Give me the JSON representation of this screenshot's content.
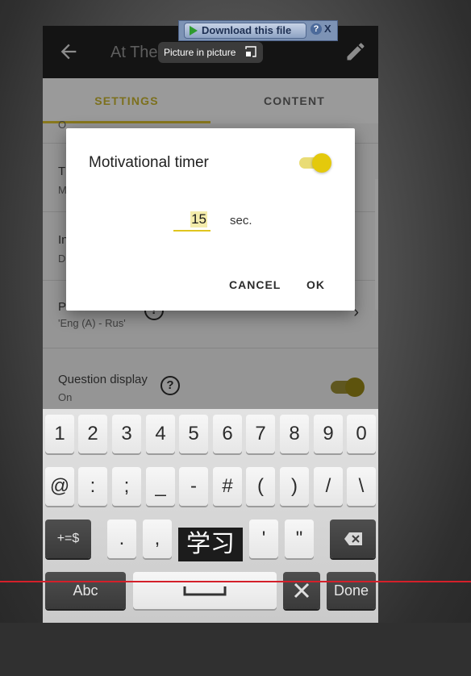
{
  "app": {
    "title": "At The"
  },
  "tabs": {
    "settings": "SETTINGS",
    "content": "CONTENT"
  },
  "list": {
    "rows": [
      {
        "title": "",
        "subtitle": "O"
      },
      {
        "title": "T",
        "subtitle": "M"
      },
      {
        "title": "In",
        "subtitle": "D"
      },
      {
        "title": "P",
        "subtitle": "'Eng (A) - Rus'"
      },
      {
        "title": "Question display",
        "subtitle": "On"
      }
    ]
  },
  "dialog": {
    "title": "Motivational timer",
    "toggle_on": true,
    "value": "15",
    "unit": "sec.",
    "cancel": "CANCEL",
    "ok": "OK"
  },
  "keyboard": {
    "row1": [
      "1",
      "2",
      "3",
      "4",
      "5",
      "6",
      "7",
      "8",
      "9",
      "0"
    ],
    "row2": [
      "@",
      ":",
      ";",
      "_",
      "-",
      "#",
      "(",
      ")",
      "/",
      "\\"
    ],
    "row3": {
      "sym": "+=$",
      "keys": [
        ".",
        ",",
        "'",
        "\""
      ]
    },
    "row4": {
      "abc": "Abc",
      "done": "Done"
    }
  },
  "overlays": {
    "pip_label": "Picture in picture",
    "download": "Download this file",
    "download_help": "?",
    "download_close": "X",
    "subtitle": "学习"
  },
  "colors": {
    "accent": "#e4c90c",
    "tab_active": "#b7a52c",
    "progress_line": "#d4202a"
  },
  "icons": [
    "back-arrow-icon",
    "pencil-icon",
    "help-icon",
    "chevron-right-icon",
    "backspace-icon",
    "tools-icon",
    "pip-icon",
    "play-icon"
  ]
}
